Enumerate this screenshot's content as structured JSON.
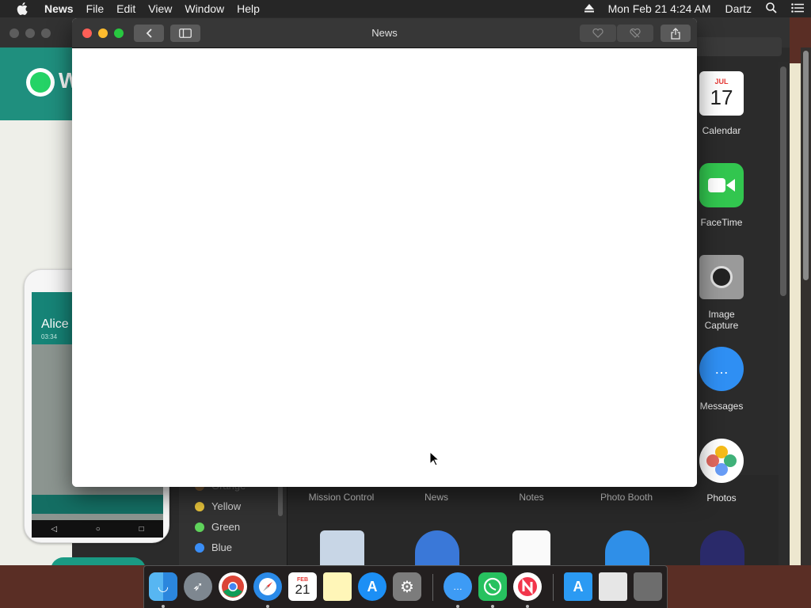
{
  "menubar": {
    "apple_icon": "apple-icon",
    "app_name": "News",
    "menus": [
      "File",
      "Edit",
      "View",
      "Window",
      "Help"
    ],
    "datetime": "Mon Feb 21  4:24 AM",
    "user": "Dartz"
  },
  "background_window": {
    "brand": "W",
    "phone_contact": "Alice",
    "phone_time": "03:34"
  },
  "news_window": {
    "title": "News"
  },
  "finder_sidebar": {
    "tags": [
      {
        "label": "Orange",
        "color": "#f09a37"
      },
      {
        "label": "Yellow",
        "color": "#e7c33b"
      },
      {
        "label": "Green",
        "color": "#5fd35b"
      },
      {
        "label": "Blue",
        "color": "#3a8ef6"
      }
    ]
  },
  "applications": {
    "row_labels": [
      "Mission Control",
      "News",
      "Notes",
      "Photo Booth",
      "Photos"
    ],
    "column_right": [
      {
        "label": "Calendar",
        "icon": "calendar-icon",
        "month": "JUL",
        "day": "17"
      },
      {
        "label": "FaceTime",
        "icon": "facetime-icon"
      },
      {
        "label": "Image Capture",
        "icon": "image-capture-icon"
      },
      {
        "label": "Messages",
        "icon": "messages-icon"
      },
      {
        "label": "Photos",
        "icon": "photos-icon"
      }
    ]
  },
  "dock": {
    "items": [
      {
        "name": "Finder",
        "icon": "finder-icon"
      },
      {
        "name": "Launchpad",
        "icon": "launchpad-icon"
      },
      {
        "name": "Chrome",
        "icon": "chrome-icon"
      },
      {
        "name": "Safari",
        "icon": "safari-icon"
      },
      {
        "name": "Calendar",
        "icon": "calendar-icon",
        "month": "FEB",
        "day": "21"
      },
      {
        "name": "Notes",
        "icon": "notes-icon"
      },
      {
        "name": "App Store",
        "icon": "app-store-icon"
      },
      {
        "name": "System Preferences",
        "icon": "system-preferences-icon"
      },
      {
        "name": "Messages",
        "icon": "messages-icon"
      },
      {
        "name": "WhatsApp",
        "icon": "whatsapp-icon"
      },
      {
        "name": "News",
        "icon": "news-icon"
      },
      {
        "name": "Applications",
        "icon": "applications-folder-icon"
      },
      {
        "name": "Downloads",
        "icon": "downloads-icon"
      },
      {
        "name": "Trash",
        "icon": "trash-icon"
      }
    ]
  }
}
